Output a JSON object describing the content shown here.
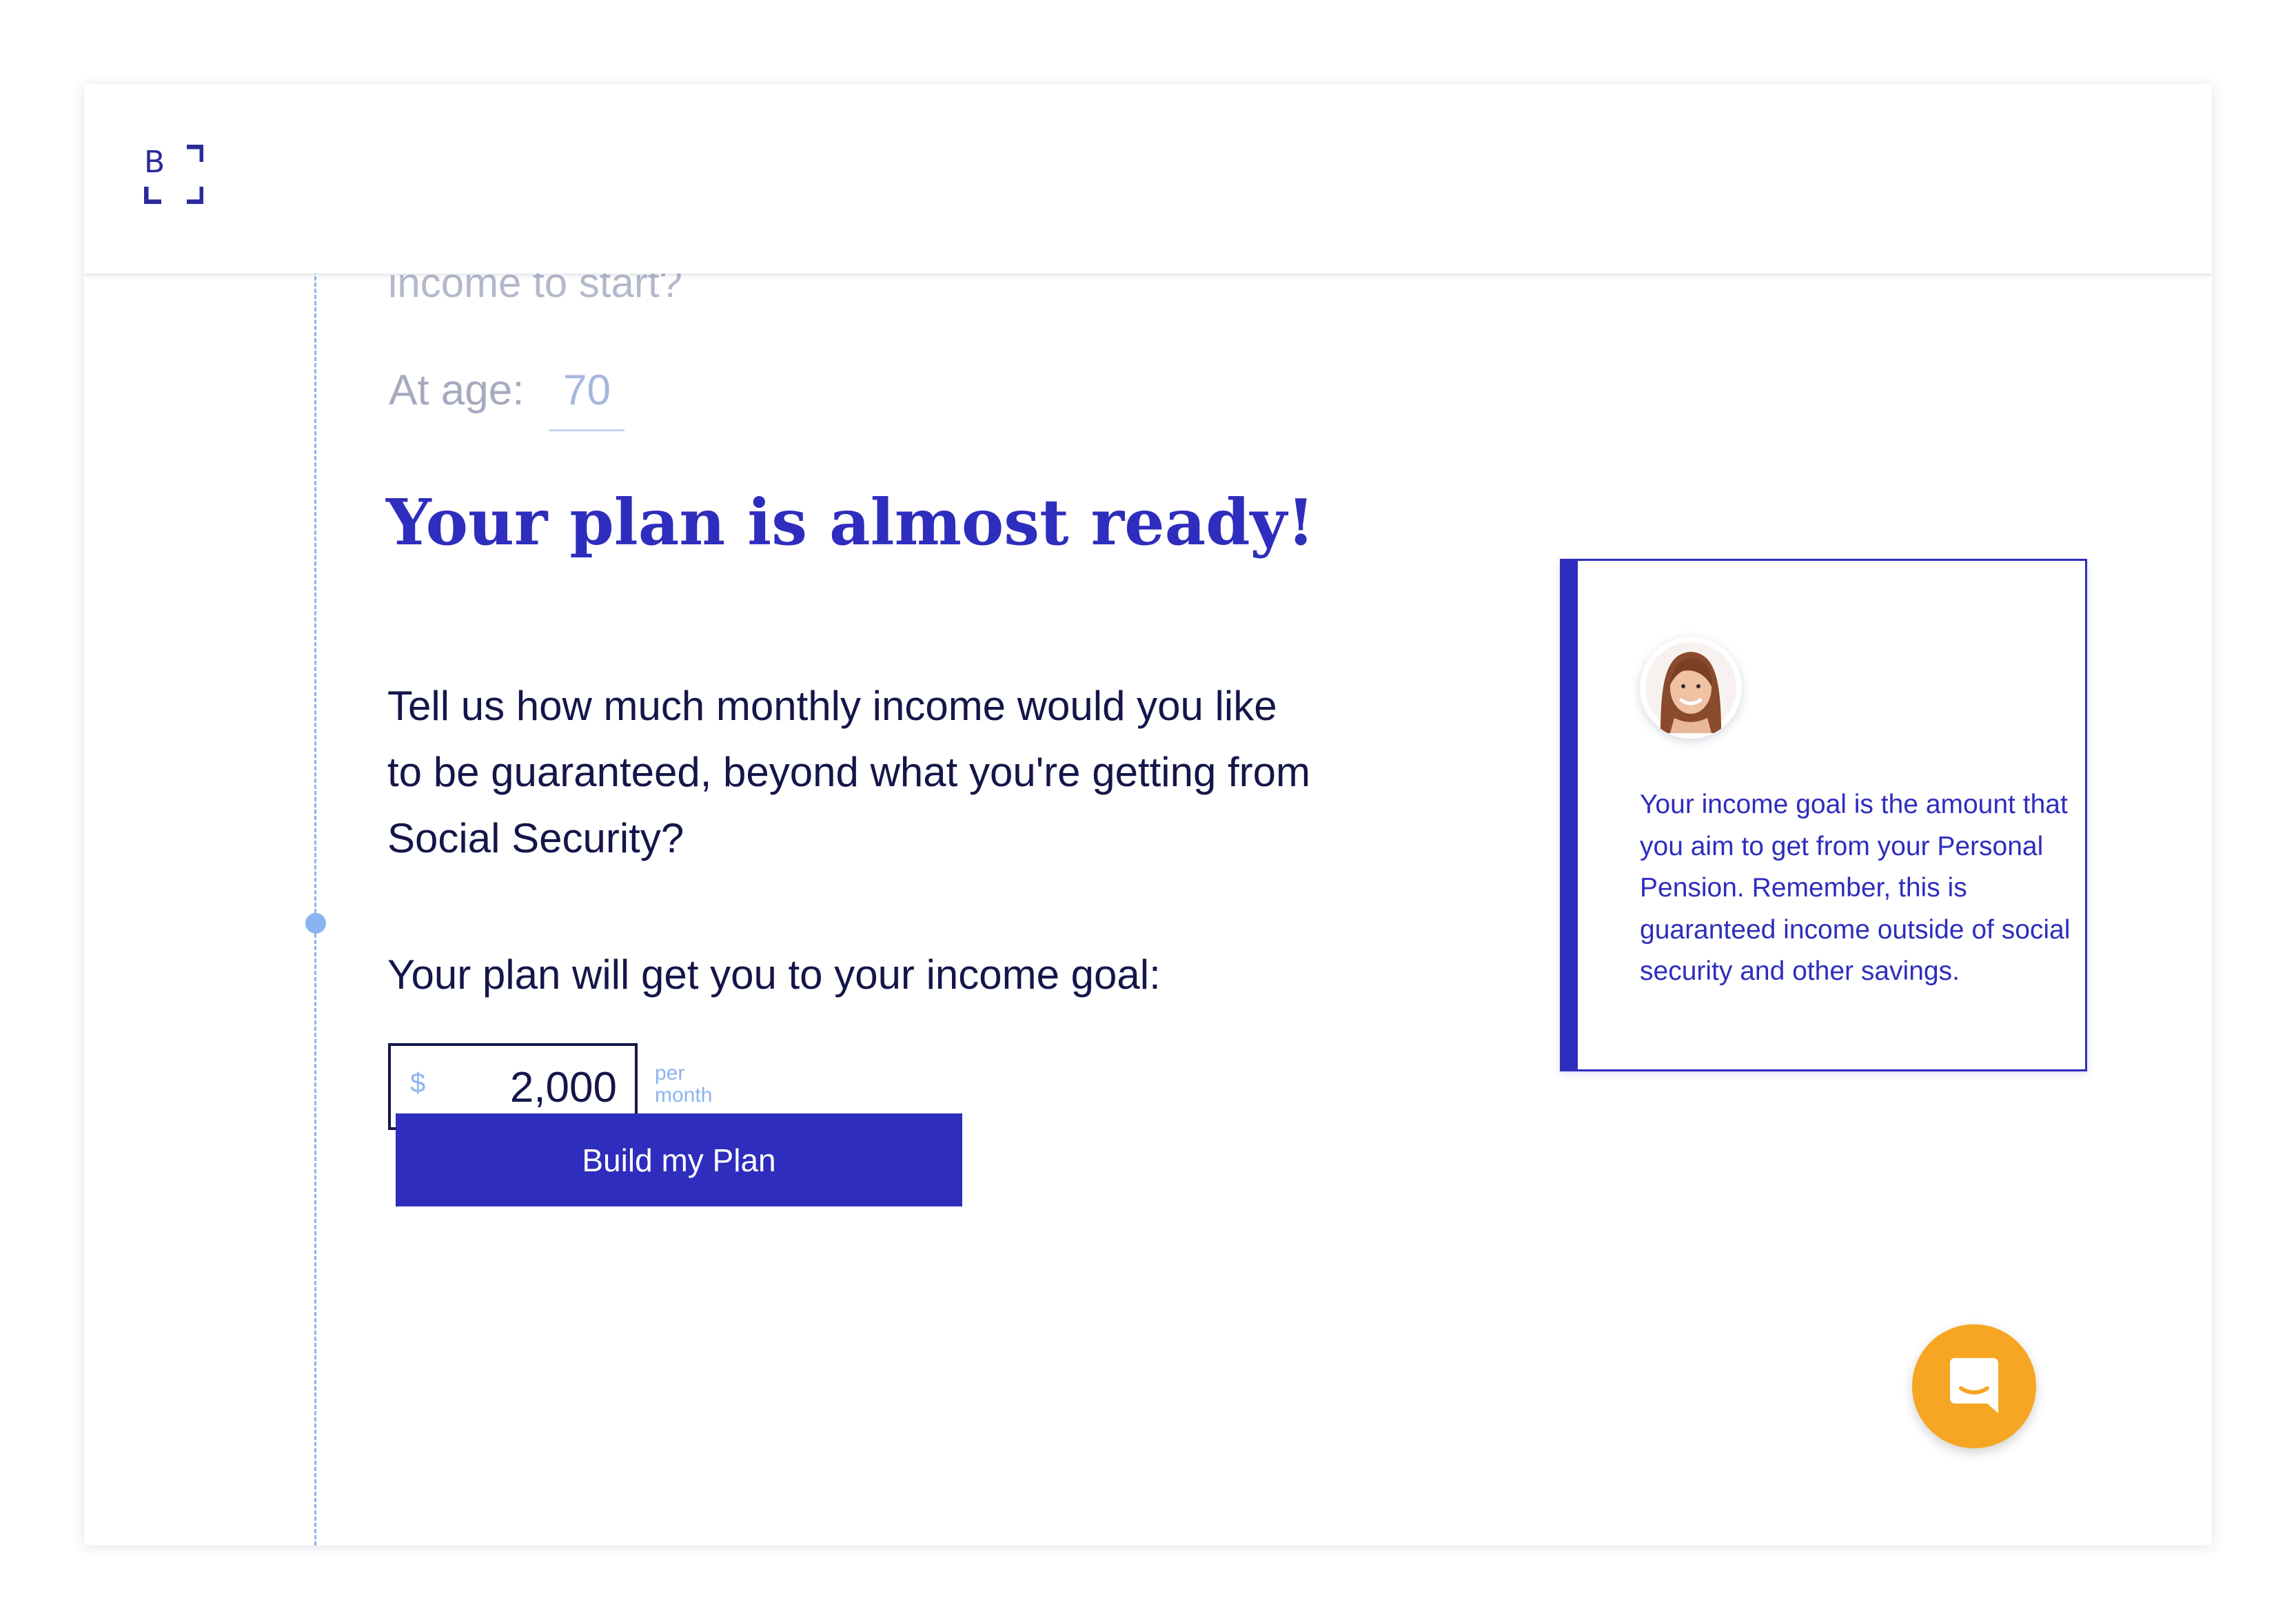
{
  "header": {
    "logo_letter": "B"
  },
  "previous_question": {
    "text": "income to start?",
    "age_label": "At age:",
    "age_value": "70"
  },
  "main": {
    "headline": "Your plan is almost ready!",
    "description": "Tell us how much monthly income would you like to be guaranteed, beyond what you're getting from Social Security?",
    "goal_label": "Your plan will get you to your income goal:",
    "currency_symbol": "$",
    "amount_value": "2,000",
    "per_label": "per",
    "month_label": "month",
    "build_button_label": "Build my Plan"
  },
  "tip": {
    "text": "Your income goal is the amount that you aim to get from your Personal Pension. Remember, this is guaranteed income outside of social security and other savings."
  },
  "icons": {
    "logo": "logo-icon",
    "avatar": "advisor-avatar",
    "chat": "chat-bubble-icon"
  },
  "colors": {
    "brand_blue": "#2e2dbd",
    "navy_text": "#14164a",
    "light_blue": "#8ab4ef",
    "chat_orange": "#f6a623"
  }
}
